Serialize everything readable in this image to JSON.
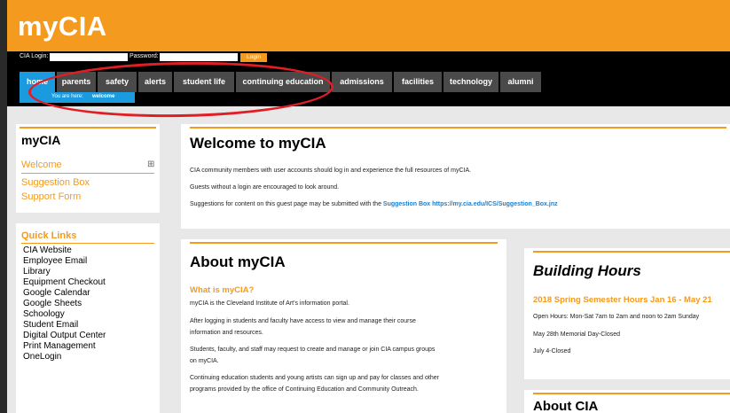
{
  "header": {
    "logo": "myCIA"
  },
  "login": {
    "login_label": "CIA Login:",
    "password_label": "Password:",
    "button_label": "Login"
  },
  "nav": {
    "tabs": [
      "home",
      "parents",
      "safety",
      "alerts",
      "student life",
      "continuing education",
      "admissions",
      "facilities",
      "technology",
      "alumni"
    ],
    "you_are_here": "You are here:",
    "current": "welcome"
  },
  "sidebar": {
    "title": "myCIA",
    "links": [
      "Welcome",
      "Suggestion Box",
      "Support Form"
    ],
    "expand_icon": "⊞"
  },
  "quicklinks": {
    "title": "Quick Links",
    "items": [
      "CIA Website",
      "Employee Email",
      "Library",
      "Equipment Checkout",
      "Google Calendar",
      "Google Sheets",
      "Schoology",
      "Student Email",
      "Digital Output Center",
      "Print Management",
      "OneLogin"
    ]
  },
  "welcome": {
    "title": "Welcome to myCIA",
    "p1": "CIA community members with user accounts should log in and experience the full resources of myCIA.",
    "p2": "Guests without a login are encouraged to look around.",
    "p3": "Suggestions for content on this guest page may be submitted with the",
    "p3_link": "Suggestion Box https://my.cia.edu/ICS/Suggestion_Box.jnz"
  },
  "about": {
    "title": "About myCIA",
    "subtitle": "What is myCIA?",
    "p1": "myCIA is the Cleveland Institute of Art's information portal.",
    "p2a": "After logging in students and faculty have access to view and manage their course",
    "p2b": "information and resources.",
    "p3a": "Students, faculty, and staff may request to create and manage or join CIA campus groups",
    "p3b": "on myCIA.",
    "p4a": "Continuing education students and young artists can sign up and pay for classes and other",
    "p4b": "programs provided by the office of Continuing Education and Community Outreach."
  },
  "hours": {
    "title": "Building Hours",
    "subtitle": "2018 Spring Semester Hours Jan 16 - May 21",
    "line1": "Open Hours: Mon-Sat 7am to 2am and noon to 2am Sunday",
    "line2": "May 28th Memorial Day-Closed",
    "line3": "July 4-Closed"
  },
  "about_cia": {
    "title": "About CIA"
  }
}
